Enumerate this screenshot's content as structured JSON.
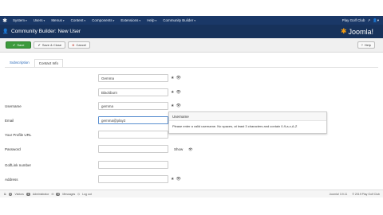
{
  "topbar": {
    "menu": [
      {
        "label": "System"
      },
      {
        "label": "Users"
      },
      {
        "label": "Menus"
      },
      {
        "label": "Content"
      },
      {
        "label": "Components"
      },
      {
        "label": "Extensions"
      },
      {
        "label": "Help"
      },
      {
        "label": "Community Builder"
      }
    ],
    "site_name": "Play Golf Club"
  },
  "header": {
    "title": "Community Builder: New User",
    "brand": "Joomla!"
  },
  "toolbar": {
    "save": "Save",
    "save_close": "Save & Close",
    "cancel": "Cancel",
    "help": "Help"
  },
  "tabs": [
    {
      "label": "Subscription",
      "active": false
    },
    {
      "label": "Contact Info",
      "active": true
    }
  ],
  "form": {
    "firstname_value": "Gemma",
    "lastname_value": "Blackburn",
    "username_label": "Username",
    "username_value": "gemma",
    "email_label": "Email",
    "email_value": "gemma@play2",
    "profile_url_label": "Your Profile URL",
    "password_label": "Password",
    "show_label": "Show",
    "golflink_label": "GolfLink number",
    "address_label": "Address"
  },
  "tooltip": {
    "title": "Username",
    "body": "Please enter a valid username. No spaces, at least 3 characters and contain 0-9,a-z,A-Z"
  },
  "statusbar": {
    "visitors_count": "0",
    "visitors_label": "Visitors",
    "admins_count": "1",
    "admins_label": "Administrator",
    "messages_count": "0",
    "messages_label": "Messages",
    "logout": "Log out",
    "version": "Joomla! 3.9.11",
    "copyright": "© 2019 Play Golf Club"
  }
}
